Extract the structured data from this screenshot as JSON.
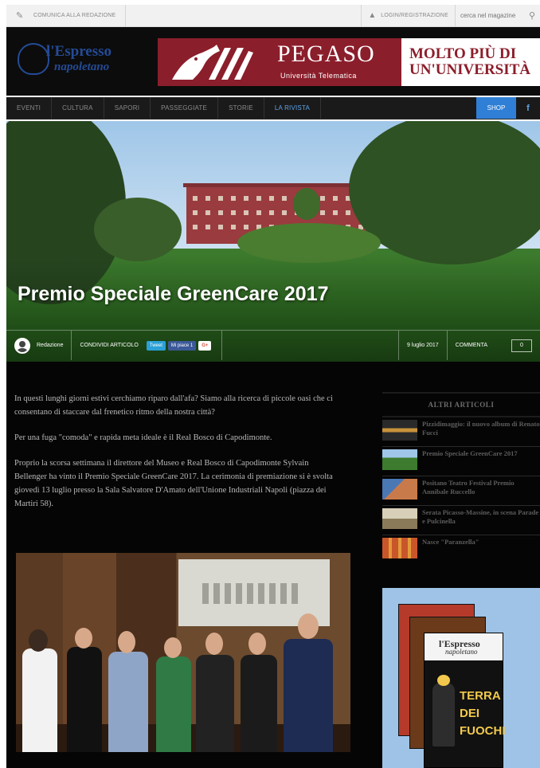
{
  "topbar": {
    "contact_label": "COMUNICA ALLA REDAZIONE",
    "login_label": "LOGIN/REGISTRAZIONE",
    "search_placeholder": "cerca nel magazine"
  },
  "logo": {
    "line1": "l'Espresso",
    "line2": "napoletano"
  },
  "banner": {
    "brand": "PEGASO",
    "brand_sub": "Università Telematica",
    "slogan_line1": "MOLTO PIÙ DI",
    "slogan_line2": "UN'UNIVERSITÀ"
  },
  "nav": {
    "items": [
      "EVENTI",
      "CULTURA",
      "SAPORI",
      "PASSEGGIATE",
      "STORIE",
      "LA RIVISTA"
    ],
    "shop_label": "SHOP",
    "fb_label": "f"
  },
  "hero": {
    "title": "Premio Speciale GreenCare 2017",
    "author": "Redazione",
    "share_label": "CONDIVIDI ARTICOLO",
    "tweet_label": "Tweet",
    "like_label": "Mi piace 1",
    "gplus_label": "G+",
    "date": "9 luglio 2017",
    "comments_label": "COMMENTA",
    "comments_count": "0"
  },
  "article": {
    "paragraphs": [
      "In questi lunghi giorni estivi cerchiamo riparo dall'afa? Siamo alla ricerca di piccole oasi che ci consentano di staccare dal frenetico ritmo della nostra città?",
      "Per una fuga \"comoda\" e rapida meta ideale è il Real Bosco di Capodimonte.",
      "Proprio la scorsa settimana il direttore del Museo e Real Bosco di Capodimonte Sylvain Bellenger ha vinto il Premio Speciale GreenCare 2017. La cerimonia di premiazione si è svolta giovedì 13 luglio presso la Sala Salvatore D'Amato dell'Unione Industriali Napoli (piazza dei Martiri 58)."
    ]
  },
  "sidebar": {
    "header": "ALTRI ARTICOLI",
    "articles": [
      "Pizzidimaggio: il nuovo album di Renato Fucci",
      "Premio Speciale GreenCare 2017",
      "Positano Teatro Festival Premio Annibale Ruccello",
      "Serata Picasso-Massine, in scena Parade e Pulcinella",
      "Nasce \"Paranzella\""
    ]
  },
  "magazine": {
    "logo1": "l'Espresso",
    "logo2": "napoletano",
    "headline1": "TERRA",
    "headline2": "DEI",
    "headline3": "FUOCHI"
  },
  "colors": {
    "accent": "#2f7fd6",
    "brand_red": "#8b1e2b",
    "logo_blue": "#244b96"
  }
}
